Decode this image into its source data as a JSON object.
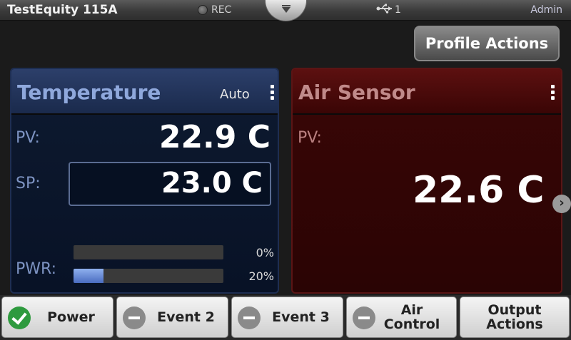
{
  "status_bar": {
    "device_name": "TestEquity 115A",
    "rec_label": "REC",
    "usb_count": "1",
    "user": "Admin"
  },
  "profile_actions_label": "Profile Actions",
  "temperature_panel": {
    "title": "Temperature",
    "mode": "Auto",
    "pv_label": "PV:",
    "pv_value": "22.9 C",
    "sp_label": "SP:",
    "sp_value": "23.0 C",
    "pwr_label": "PWR:",
    "power_bars": [
      {
        "percent_label": "0%",
        "level": 0
      },
      {
        "percent_label": "20%",
        "level": 20
      }
    ]
  },
  "air_sensor_panel": {
    "title": "Air Sensor",
    "pv_label": "PV:",
    "pv_value": "22.6 C"
  },
  "bottom_bar": {
    "buttons": [
      {
        "label": "Power",
        "state": "on"
      },
      {
        "label": "Event 2",
        "state": "off"
      },
      {
        "label": "Event 3",
        "state": "off"
      },
      {
        "label": "Air Control",
        "state": "off"
      },
      {
        "label": "Output Actions"
      }
    ]
  },
  "colors": {
    "temperature_panel_bg": "#0e1a30",
    "air_panel_bg": "#3a0606",
    "on_indicator": "#2e9a3e",
    "off_indicator": "#8a8a8a"
  }
}
